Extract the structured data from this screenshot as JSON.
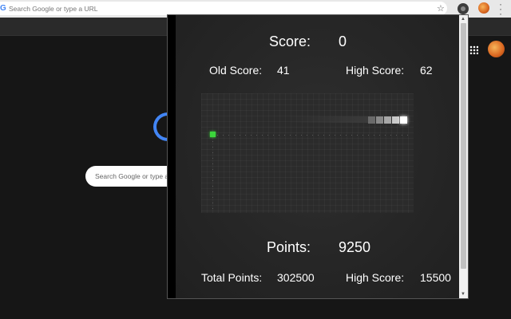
{
  "browser": {
    "omnibox_placeholder": "Search Google or type a URL",
    "ntp_search_placeholder": "Search Google or type a URL"
  },
  "game": {
    "score_label": "Score:",
    "score_value": "0",
    "old_score_label": "Old Score:",
    "old_score_value": "41",
    "high_score_label": "High Score:",
    "high_score_value": "62",
    "points_label": "Points:",
    "points_value": "9250",
    "total_points_label": "Total Points:",
    "total_points_value": "302500",
    "points_high_score_label": "High Score:",
    "points_high_score_value": "15500"
  },
  "colors": {
    "food": "#3cd63c",
    "snake_head": "#ffffff",
    "accent_blue": "#4285f4"
  }
}
